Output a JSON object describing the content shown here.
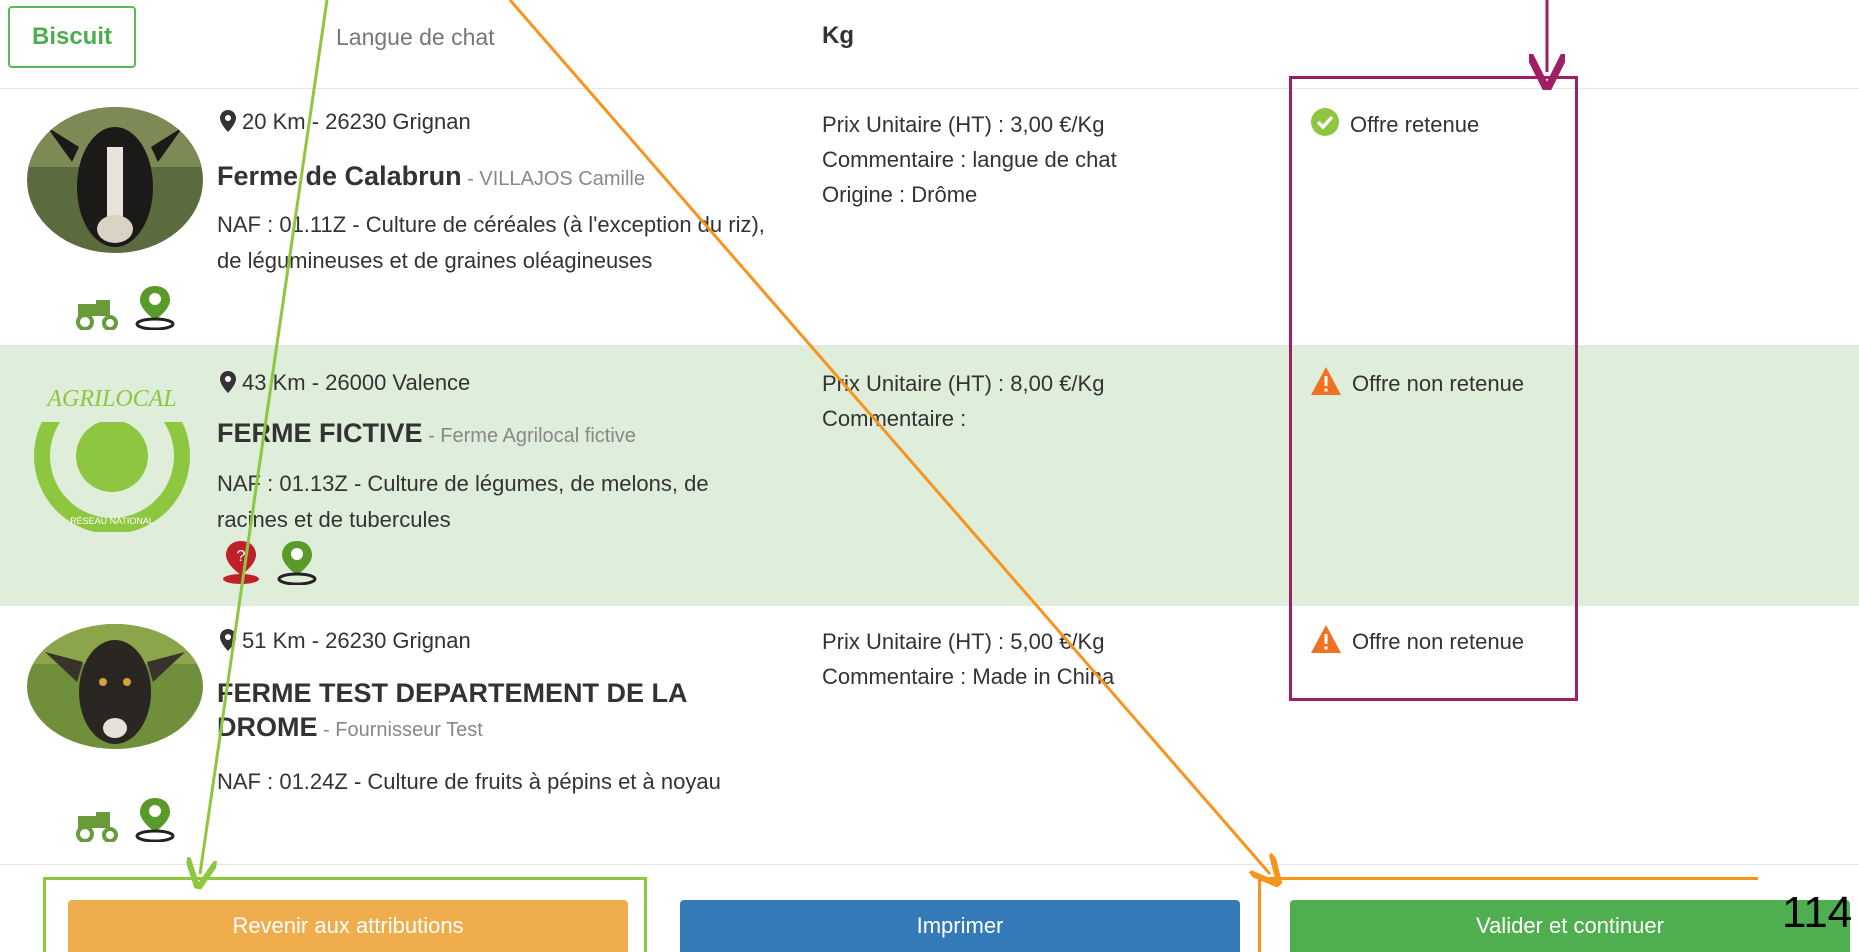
{
  "header": {
    "product_badge": "Biscuit",
    "product_name": "Langue de chat",
    "unit": "Kg"
  },
  "offers": [
    {
      "distance": "20 Km  -  26230 Grignan",
      "farm_name": "Ferme de Calabrun",
      "owner": " - VILLAJOS Camille",
      "naf": "NAF : 01.11Z - Culture de céréales (à l'exception du riz), de légumineuses et de graines oléagineuses",
      "price": "Prix Unitaire (HT)  :  3,00 €/Kg",
      "comment": "Commentaire  :  langue de chat",
      "origin": "Origine  :  Drôme",
      "status": "Offre retenue",
      "status_icon": "check-circle-icon",
      "status_color": "#8dc63f",
      "icons": [
        "tractor-icon",
        "map-pin-person-icon"
      ]
    },
    {
      "distance": "43 Km  -  26000 Valence",
      "farm_name": "FERME FICTIVE",
      "owner": " - Ferme Agrilocal fictive",
      "naf": "NAF : 01.13Z - Culture de légumes, de melons, de racines et de tubercules",
      "price": "Prix Unitaire (HT)  :  8,00 €/Kg",
      "comment": "Commentaire  :",
      "origin": "",
      "status": "Offre non retenue",
      "status_icon": "warning-icon",
      "status_color": "#f0711f",
      "icons": [
        "question-person-icon",
        "map-pin-person-icon"
      ],
      "logo_text": "AGRILOCAL",
      "logo_subtext": "RÉSEAU NATIONAL"
    },
    {
      "distance": "51 Km  -  26230 Grignan",
      "farm_name": "FERME TEST DEPARTEMENT DE LA DROME",
      "owner": " - Fournisseur Test",
      "naf": "NAF : 01.24Z - Culture de fruits à pépins et à noyau",
      "price": "Prix Unitaire (HT)  :  5,00 €/Kg",
      "comment": "Commentaire  :  Made in China",
      "origin": "",
      "status": "Offre non retenue",
      "status_icon": "warning-icon",
      "status_color": "#f0711f",
      "icons": [
        "tractor-icon",
        "map-pin-person-icon"
      ]
    }
  ],
  "buttons": {
    "back": "Revenir aux attributions",
    "print": "Imprimer",
    "validate": "Valider et continuer"
  },
  "page_number": "114",
  "colors": {
    "highlight_row": "#dfeeda",
    "annotation_green": "#8dc63f",
    "annotation_orange": "#f7941d",
    "annotation_purple": "#9e1f63"
  }
}
